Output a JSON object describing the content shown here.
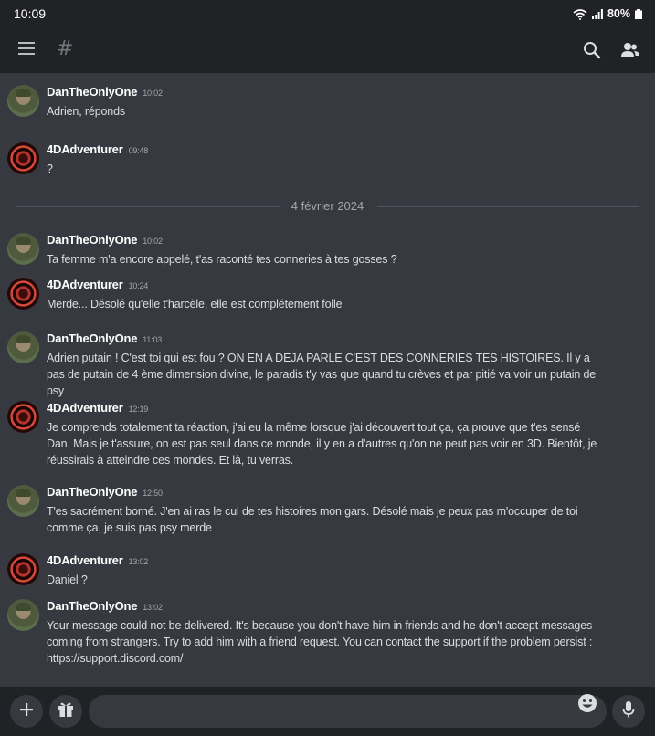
{
  "status_bar": {
    "time": "10:09",
    "battery": "80%"
  },
  "header": {
    "channel_symbol": "#"
  },
  "divider": {
    "label": "4 février 2024"
  },
  "messages": [
    {
      "author": "DanTheOnlyOne",
      "time": "10:02",
      "avatar": "dan",
      "text": "Adrien, réponds"
    },
    {
      "author": "4DAdventurer",
      "time": "09:48",
      "avatar": "adv",
      "text": "?"
    },
    {
      "author": "DanTheOnlyOne",
      "time": "10:02",
      "avatar": "dan",
      "text": "Ta femme m'a encore appelé, t'as raconté tes conneries à tes gosses ?"
    },
    {
      "author": "4DAdventurer",
      "time": "10:24",
      "avatar": "adv",
      "text": "Merde... Désolé qu'elle t'harcèle, elle est complétement folle"
    },
    {
      "author": "DanTheOnlyOne",
      "time": "11:03",
      "avatar": "dan",
      "text": "Adrien putain ! C'est toi qui est fou ? ON EN A DEJA PARLE C'EST DES CONNERIES TES HISTOIRES. Il y a pas de putain de 4 ème dimension divine, le paradis t'y vas que quand tu crèves et par pitié va voir un putain de psy"
    },
    {
      "author": "4DAdventurer",
      "time": "12:19",
      "avatar": "adv",
      "text": "Je comprends totalement ta réaction, j'ai eu la même lorsque j'ai découvert tout ça, ça prouve que t'es sensé Dan. Mais je t'assure, on est pas seul dans ce monde, il y en a d'autres qu'on ne peut pas voir en 3D. Bientôt, je réussirais à atteindre ces mondes. Et là, tu verras."
    },
    {
      "author": "DanTheOnlyOne",
      "time": "12:50",
      "avatar": "dan",
      "text": "T'es sacrément borné. J'en ai ras le cul de tes histoires mon gars. Désolé mais je peux pas m'occuper de toi comme ça, je suis pas psy merde"
    },
    {
      "author": "4DAdventurer",
      "time": "13:02",
      "avatar": "adv",
      "text": "Daniel ?"
    },
    {
      "author": "DanTheOnlyOne",
      "time": "13:02",
      "avatar": "dan",
      "text": "Your message could not be delivered. It's because you don't have him in friends and he don't accept messages coming from strangers. Try to add him with a friend request. You can contact the support if the problem persist : https://support.discord.com/"
    }
  ],
  "icons": [
    "menu-icon",
    "search-icon",
    "members-icon",
    "plus-icon",
    "gift-icon",
    "emoji-icon",
    "microphone-icon"
  ]
}
